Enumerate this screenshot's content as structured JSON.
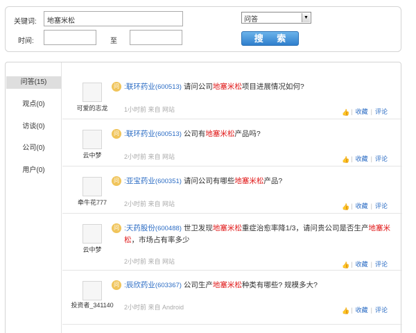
{
  "search": {
    "keyword_label": "关键词:",
    "keyword_value": "地塞米松",
    "time_label": "时间:",
    "to_label": "至",
    "category_selected": "问答",
    "search_button": "搜 索"
  },
  "sidebar": {
    "items": [
      {
        "label": "问答(15)",
        "active": true
      },
      {
        "label": "观点(0)"
      },
      {
        "label": "访谈(0)"
      },
      {
        "label": "公司(0)"
      },
      {
        "label": "用户(0)"
      }
    ]
  },
  "icons": {
    "question": "问",
    "like": "👍"
  },
  "results": [
    {
      "user": "可爱的志龙",
      "stock": ":联环药业",
      "code": "(600513)",
      "q_before": "请问公司",
      "q_hl": "地塞米松",
      "q_after": "项目进展情况如何?",
      "meta": "1小时前  来自  网站",
      "collect": "收藏",
      "comment": "评论"
    },
    {
      "user": "云中梦",
      "stock": ":联环药业",
      "code": "(600513)",
      "q_before": "公司有",
      "q_hl": "地塞米松",
      "q_after": "产品吗?",
      "meta": "2小时前  来自  网站",
      "collect": "收藏",
      "comment": "评论"
    },
    {
      "user": "牵牛花777",
      "stock": ":亚宝药业",
      "code": "(600351)",
      "q_before": "请问公司有哪些",
      "q_hl": "地塞米松",
      "q_after": "产品?",
      "meta": "2小时前  来自  网站",
      "collect": "收藏",
      "comment": "评论"
    },
    {
      "user": "云中梦",
      "stock": ":天药股份",
      "code": "(600488)",
      "q_before": "世卫发现",
      "q_hl": "地塞米松",
      "q_mid": "重症治愈率降1/3，请问贵公司是否生产",
      "q_hl2": "地塞米松",
      "q_after": "，市场占有率多少",
      "meta": "2小时前  来自  网站",
      "collect": "收藏",
      "comment": "评论"
    },
    {
      "user": "投资者_341140",
      "stock": ":辰欣药业",
      "code": "(603367)",
      "q_before": "公司生产",
      "q_hl": "地塞米松",
      "q_after": "种类有哪些? 规模多大?",
      "meta": "2小时前  来自  Android",
      "collect": "收藏",
      "comment": "评论"
    }
  ]
}
